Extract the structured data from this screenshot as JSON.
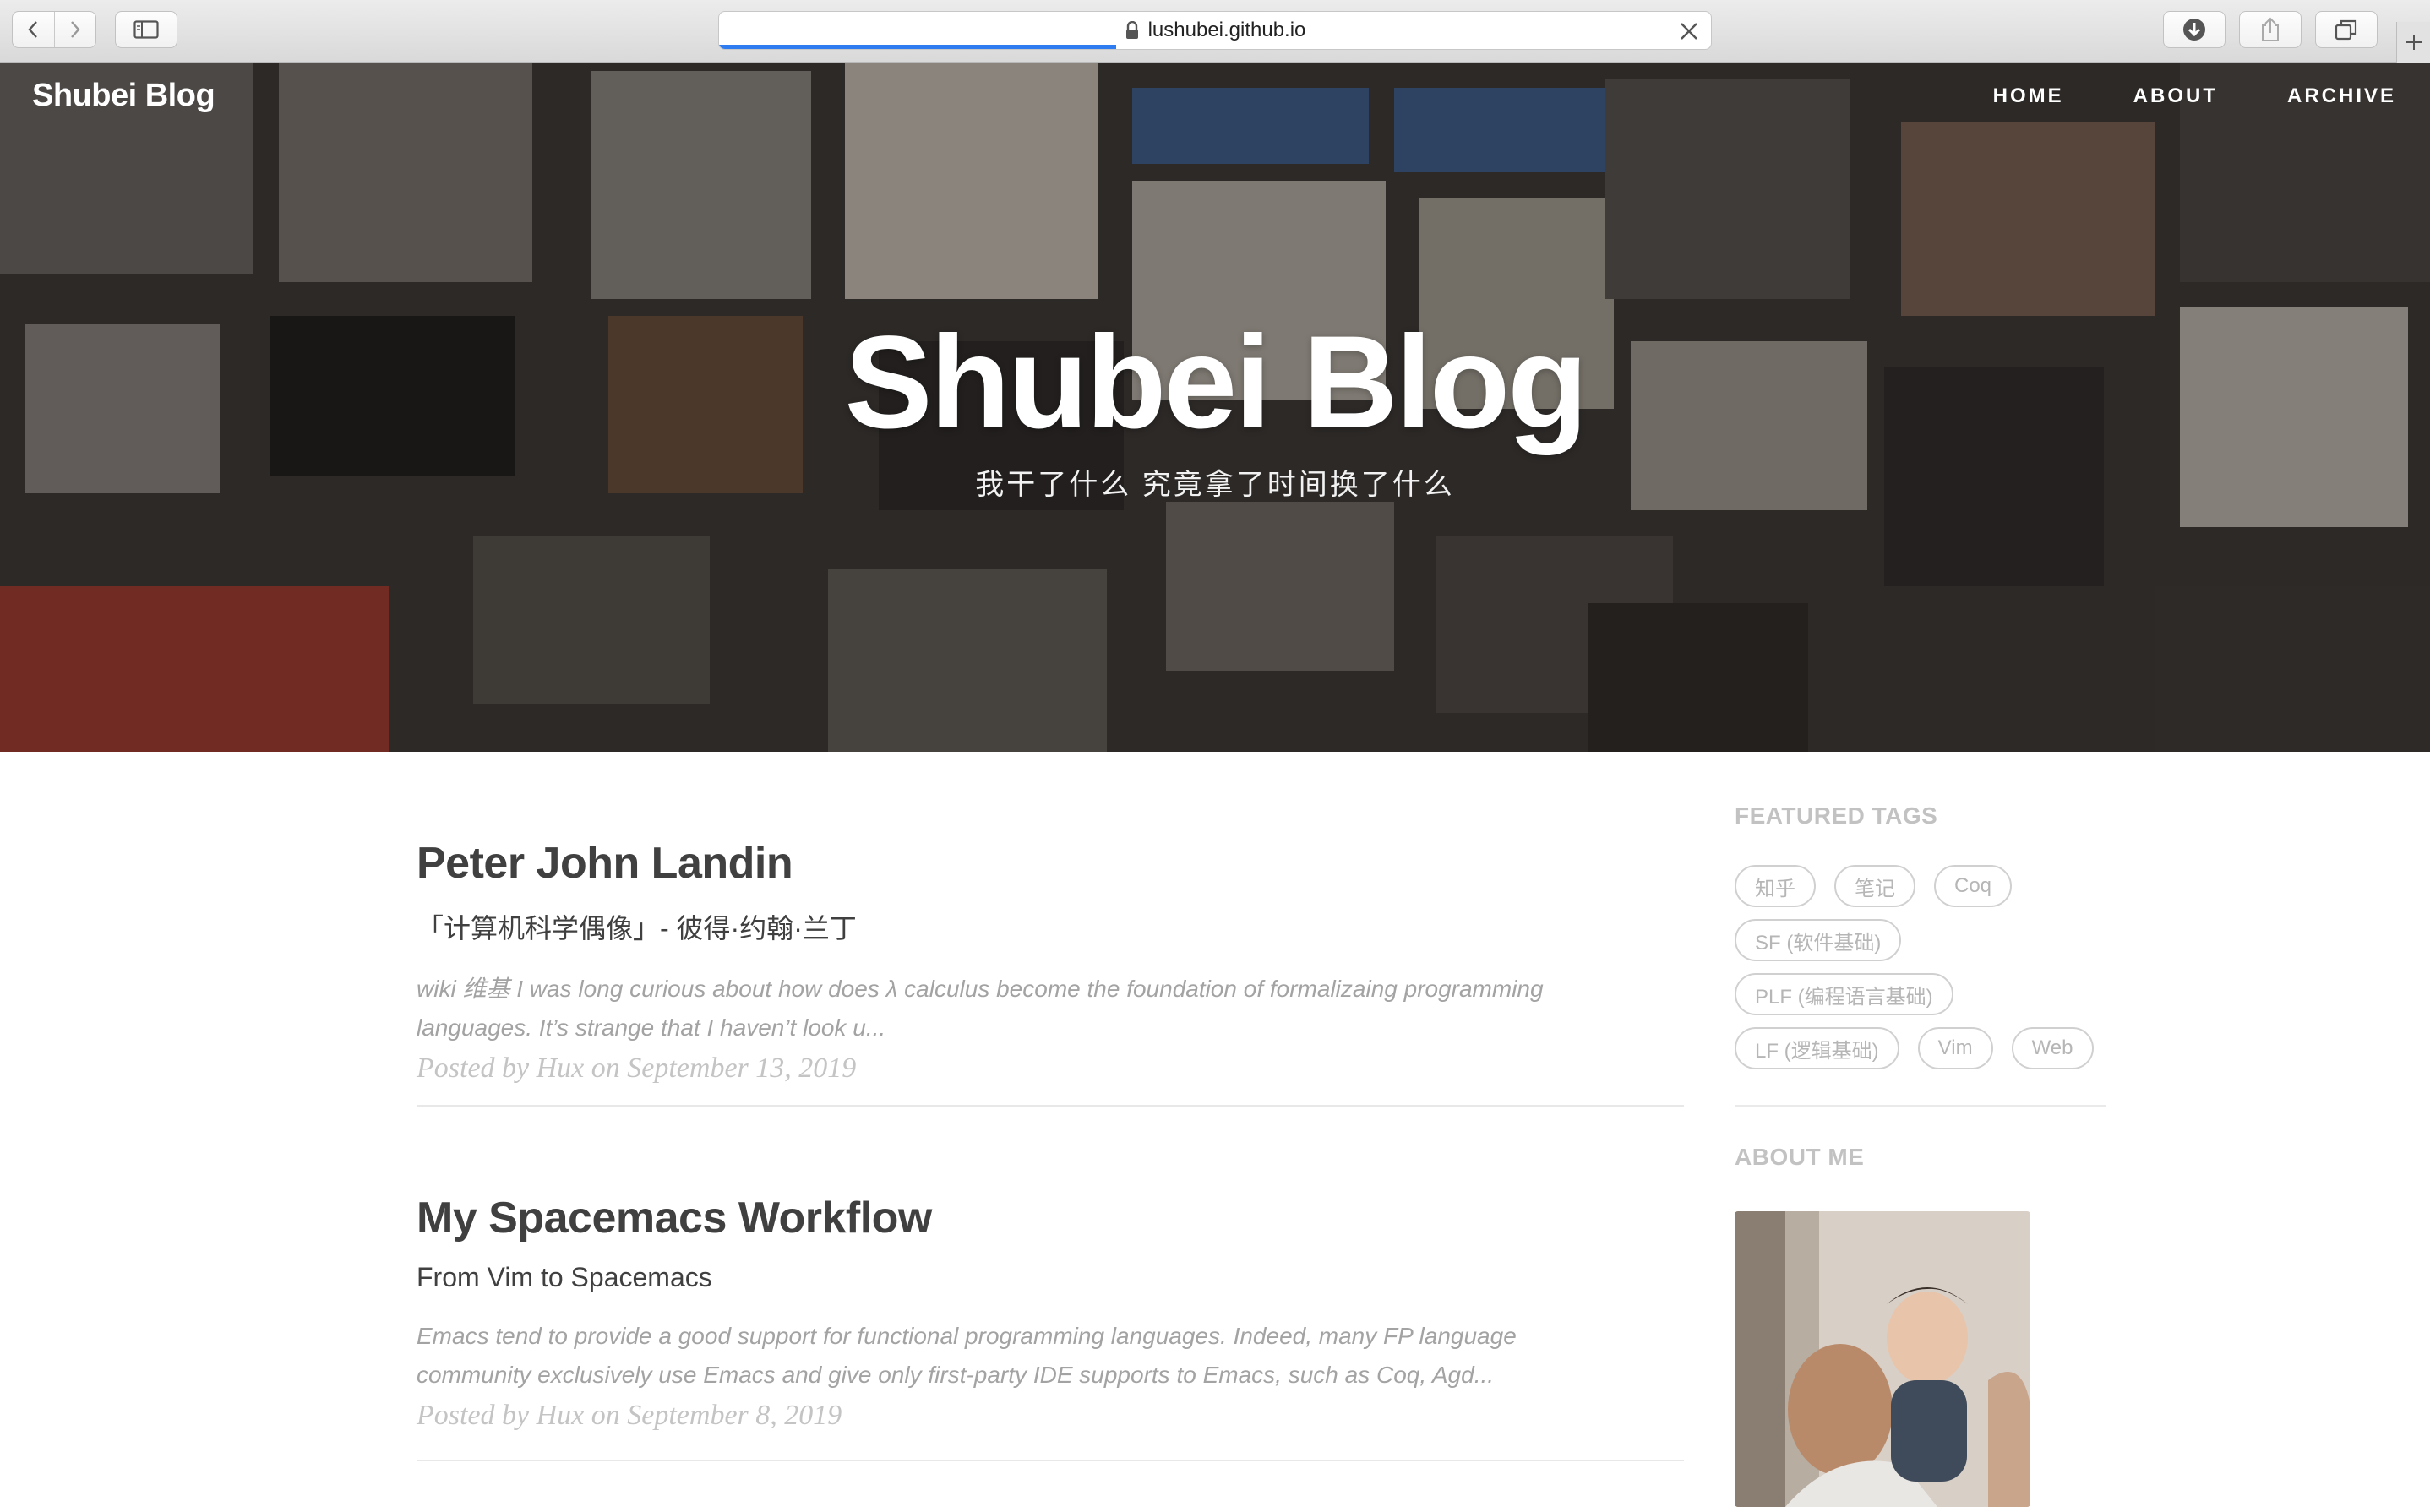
{
  "browser": {
    "url": "lushubei.github.io",
    "load_progress": 0.4,
    "icons": [
      "back-icon",
      "forward-icon",
      "sidebar-icon",
      "lock-icon",
      "close-icon",
      "download-icon",
      "share-icon",
      "tabs-icon",
      "plus-icon"
    ]
  },
  "site": {
    "brand": "Shubei Blog",
    "nav": [
      "HOME",
      "ABOUT",
      "ARCHIVE"
    ]
  },
  "hero": {
    "title": "Shubei Blog",
    "subtitle": "我干了什么 究竟拿了时间换了什么"
  },
  "posts": [
    {
      "title": "Peter John Landin",
      "subtitle": "「计算机科学偶像」- 彼得·约翰·兰丁",
      "excerpt": "wiki 维基 I was long curious about how does λ calculus become the foundation of formalizaing programming languages. It’s strange that I haven’t look u...",
      "meta": "Posted by Hux on September 13, 2019"
    },
    {
      "title": "My Spacemacs Workflow",
      "subtitle": "From Vim to Spacemacs",
      "excerpt": "Emacs tend to provide a good support for functional programming languages. Indeed, many FP language community exclusively use Emacs and give only first-party IDE supports to Emacs, such as Coq, Agd...",
      "meta": "Posted by Hux on September 8, 2019"
    }
  ],
  "sidebar": {
    "featured_tags_heading": "FEATURED TAGS",
    "tags": [
      "知乎",
      "笔记",
      "Coq",
      "SF (软件基础)",
      "PLF (编程语言基础)",
      "LF (逻辑基础)",
      "Vim",
      "Web"
    ],
    "about_heading": "ABOUT ME"
  }
}
